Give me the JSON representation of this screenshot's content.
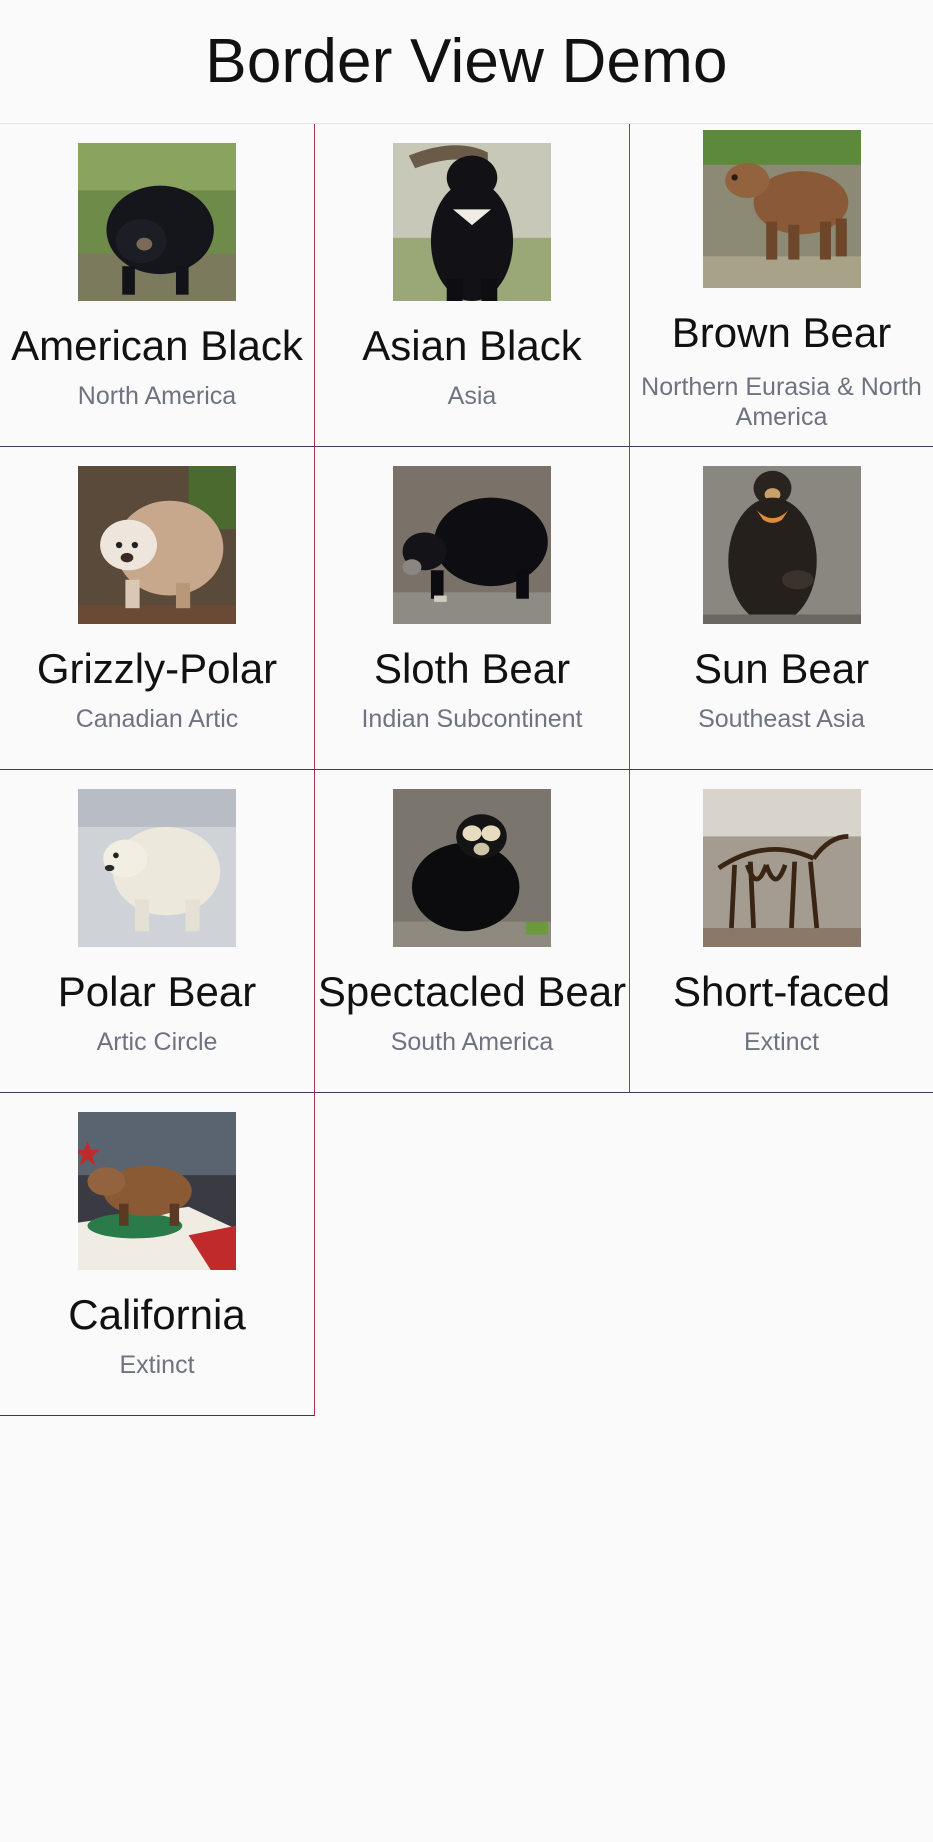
{
  "header": {
    "title": "Border View Demo"
  },
  "bears": [
    {
      "name": "American Black",
      "region": "North America",
      "icon": "american-black-bear-photo"
    },
    {
      "name": "Asian Black",
      "region": "Asia",
      "icon": "asian-black-bear-photo"
    },
    {
      "name": "Brown Bear",
      "region": "Northern Eurasia & North America",
      "icon": "brown-bear-photo"
    },
    {
      "name": "Grizzly-Polar",
      "region": "Canadian Artic",
      "icon": "grizzly-polar-bear-photo"
    },
    {
      "name": "Sloth Bear",
      "region": "Indian Subcontinent",
      "icon": "sloth-bear-photo"
    },
    {
      "name": "Sun Bear",
      "region": "Southeast Asia",
      "icon": "sun-bear-photo"
    },
    {
      "name": "Polar Bear",
      "region": "Artic Circle",
      "icon": "polar-bear-photo"
    },
    {
      "name": "Spectacled Bear",
      "region": "South America",
      "icon": "spectacled-bear-photo"
    },
    {
      "name": "Short-faced",
      "region": "Extinct",
      "icon": "short-faced-bear-skeleton-photo"
    },
    {
      "name": "California",
      "region": "Extinct",
      "icon": "california-grizzly-exhibit-photo"
    }
  ],
  "colors": {
    "background": "#fafafa",
    "vertical_border": "#b0324a",
    "horizontal_border": "#3b3b5c",
    "region_text": "#6f7380"
  }
}
